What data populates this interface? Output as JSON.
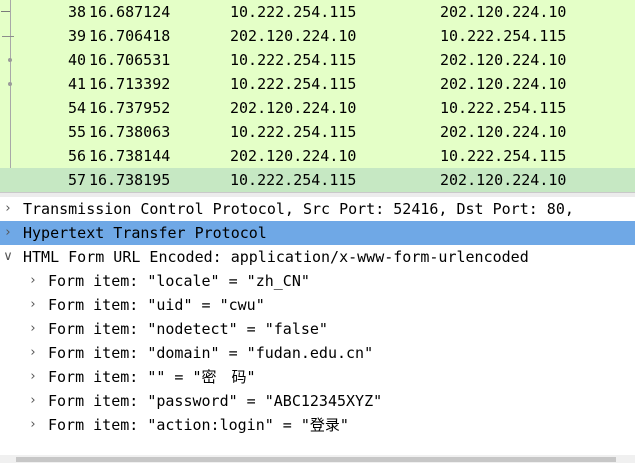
{
  "packets": [
    {
      "no": "38",
      "time": "16.687124",
      "source": "10.222.254.115",
      "destination": "202.120.224.10"
    },
    {
      "no": "39",
      "time": "16.706418",
      "source": "202.120.224.10",
      "destination": "10.222.254.115"
    },
    {
      "no": "40",
      "time": "16.706531",
      "source": "10.222.254.115",
      "destination": "202.120.224.10"
    },
    {
      "no": "41",
      "time": "16.713392",
      "source": "10.222.254.115",
      "destination": "202.120.224.10"
    },
    {
      "no": "54",
      "time": "16.737952",
      "source": "202.120.224.10",
      "destination": "10.222.254.115"
    },
    {
      "no": "55",
      "time": "16.738063",
      "source": "10.222.254.115",
      "destination": "202.120.224.10"
    },
    {
      "no": "56",
      "time": "16.738144",
      "source": "202.120.224.10",
      "destination": "10.222.254.115"
    },
    {
      "no": "57",
      "time": "16.738195",
      "source": "10.222.254.115",
      "destination": "202.120.224.10"
    }
  ],
  "selected_packet": "57",
  "details": [
    {
      "text": "Transmission Control Protocol, Src Port: 52416, Dst Port: 80,",
      "level": 0,
      "expanded": false,
      "highlighted": false
    },
    {
      "text": "Hypertext Transfer Protocol",
      "level": 0,
      "expanded": false,
      "highlighted": true
    },
    {
      "text": "HTML Form URL Encoded: application/x-www-form-urlencoded",
      "level": 0,
      "expanded": true,
      "highlighted": false
    },
    {
      "text": "Form item: \"locale\" = \"zh_CN\"",
      "level": 1,
      "expanded": false,
      "highlighted": false
    },
    {
      "text": "Form item: \"uid\" = \"cwu\"",
      "level": 1,
      "expanded": false,
      "highlighted": false
    },
    {
      "text": "Form item: \"nodetect\" = \"false\"",
      "level": 1,
      "expanded": false,
      "highlighted": false
    },
    {
      "text": "Form item: \"domain\" = \"fudan.edu.cn\"",
      "level": 1,
      "expanded": false,
      "highlighted": false
    },
    {
      "text": "Form item: \"\" = \"密　码\"",
      "level": 1,
      "expanded": false,
      "highlighted": false
    },
    {
      "text": "Form item: \"password\" = \"ABC12345XYZ\"",
      "level": 1,
      "expanded": false,
      "highlighted": false
    },
    {
      "text": "Form item: \"action:login\" = \"登录\"",
      "level": 1,
      "expanded": false,
      "highlighted": false
    }
  ],
  "icons": {
    "collapsed": "chevron-right-icon",
    "expanded": "chevron-down-icon"
  },
  "colors": {
    "packet_row_bg": "#e4ffc7",
    "packet_selected_bg": "#c6e8c3",
    "detail_highlight_bg": "#6fa8e6"
  }
}
